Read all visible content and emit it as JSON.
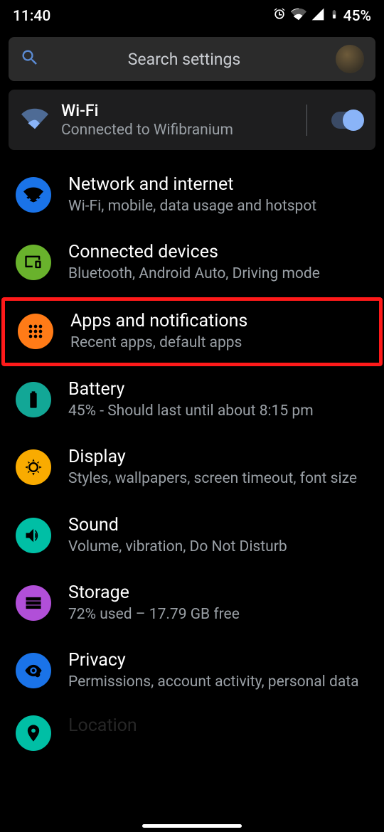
{
  "status": {
    "time": "11:40",
    "battery": "45%"
  },
  "search": {
    "placeholder": "Search settings"
  },
  "wifi": {
    "title": "Wi-Fi",
    "sub": "Connected to Wifibranium"
  },
  "items": [
    {
      "title": "Network and internet",
      "sub": "Wi-Fi, mobile, data usage and hotspot"
    },
    {
      "title": "Connected devices",
      "sub": "Bluetooth, Android Auto, Driving mode"
    },
    {
      "title": "Apps and notifications",
      "sub": "Recent apps, default apps"
    },
    {
      "title": "Battery",
      "sub": "45% - Should last until about 8:15 pm"
    },
    {
      "title": "Display",
      "sub": "Styles, wallpapers, screen timeout, font size"
    },
    {
      "title": "Sound",
      "sub": "Volume, vibration, Do Not Disturb"
    },
    {
      "title": "Storage",
      "sub": "72% used – 17.79 GB free"
    },
    {
      "title": "Privacy",
      "sub": "Permissions, account activity, personal data"
    },
    {
      "title": "Location",
      "sub": ""
    }
  ]
}
